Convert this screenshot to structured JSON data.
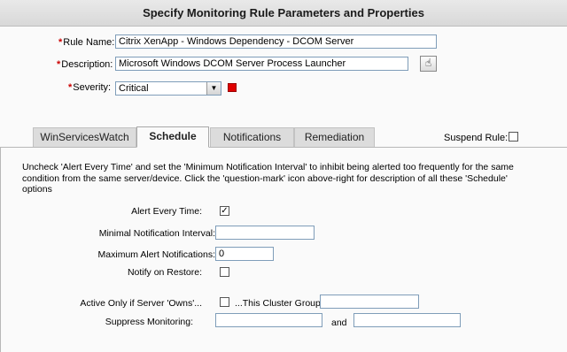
{
  "header": {
    "title": "Specify Monitoring Rule Parameters and Properties"
  },
  "form": {
    "required_mark": "*",
    "rule_name_label": "Rule Name:",
    "rule_name_value": "Citrix XenApp - Windows Dependency - DCOM Server",
    "description_label": "Description:",
    "description_value": "Microsoft Windows DCOM Server Process Launcher",
    "severity_label": "Severity:",
    "severity_value": "Critical",
    "severity_color": "#e00000",
    "description_button_icon": "hand-pointer-icon"
  },
  "tabs": [
    {
      "label": "WinServicesWatch",
      "active": false
    },
    {
      "label": "Schedule",
      "active": true
    },
    {
      "label": "Notifications",
      "active": false
    },
    {
      "label": "Remediation",
      "active": false
    }
  ],
  "suspend_rule": {
    "label": "Suspend Rule:",
    "checked": false
  },
  "schedule": {
    "instructions": "Uncheck 'Alert Every Time' and set the 'Minimum Notification Interval' to inhibit being alerted too frequently for the same condition from the same server/device. Click the 'question-mark' icon above-right for description of all these 'Schedule' options",
    "alert_every_time_label": "Alert Every Time:",
    "alert_every_time_checked": true,
    "min_interval_label": "Minimal Notification Interval:",
    "min_interval_value": "",
    "max_alerts_label": "Maximum Alert Notifications:",
    "max_alerts_value": "0",
    "notify_restore_label": "Notify on Restore:",
    "notify_restore_checked": false,
    "active_only_label": "Active Only if Server 'Owns'...",
    "active_only_checked": false,
    "cluster_group_label": "...This Cluster Group:",
    "cluster_group_value": "",
    "suppress_label": "Suppress Monitoring:",
    "suppress_from_value": "",
    "and_label": "and",
    "suppress_to_value": ""
  }
}
